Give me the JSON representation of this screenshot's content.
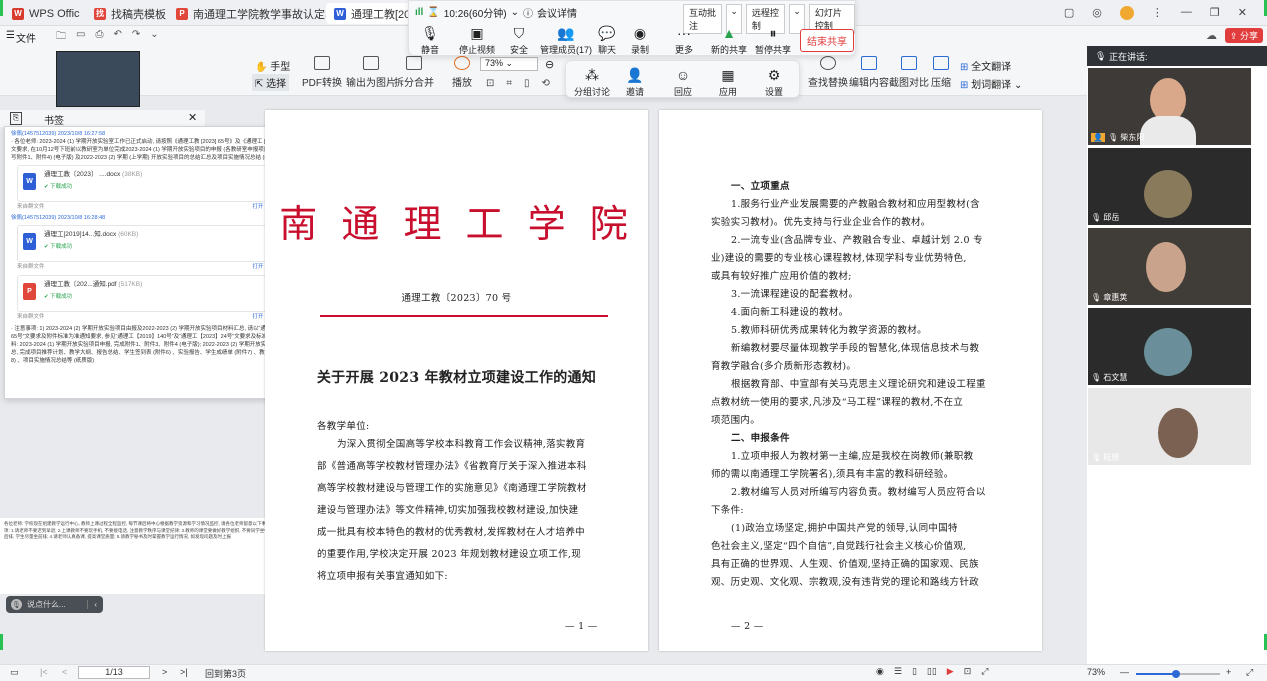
{
  "tabs": [
    {
      "label": "WPS Office",
      "icon": "W",
      "color": "#d83a2e"
    },
    {
      "label": "找稿壳模板",
      "icon": "找",
      "color": "#e0463a"
    },
    {
      "label": "南通理工学院教学事故认定与处理办",
      "icon": "P",
      "color": "#e0463a"
    },
    {
      "label": "通理工教[2023] 7",
      "icon": "W",
      "color": "#2f5fd6"
    }
  ],
  "meeting": {
    "duration": "10:26(60分钟)",
    "details": "会议详情",
    "buttons": {
      "interactive": "互动批注",
      "remote": "远程控制",
      "slides": "幻灯片控制"
    },
    "controls": [
      "静音",
      "停止视频",
      "安全",
      "管理成员(17)",
      "聊天",
      "录制",
      "更多"
    ],
    "share": [
      "新的共享",
      "暂停共享"
    ],
    "end": "结束共享",
    "sub": [
      "分组讨论",
      "邀请",
      "回应",
      "应用",
      "设置"
    ]
  },
  "menu": {
    "file": "文件"
  },
  "ribbon": {
    "hand": "手型",
    "select": "选择",
    "pdf": "PDF转换",
    "export": "输出为图片",
    "split": "拆分合并",
    "play": "播放",
    "zoom": "73%",
    "right": [
      "查找替换",
      "编辑内容",
      "截图对比",
      "压缩"
    ],
    "translate": "全文翻译",
    "word_translate": "划词翻译"
  },
  "bookmark": {
    "label": "书签"
  },
  "chat": {
    "msg1_sender": "徐佩(1457512039) 2023/10/8 16:27:58",
    "msg1_text": "· 各位老师: 2023-2024 (1) 学期开放实验室工作已正式启动, 请按照《通理工教 [2023] 65号》及《通理工 [2019] 140号》文要求, 在10月12号下班前以教研室为单位完成2023-2024 (1) 学期开放实验项目的申报 (各教研室申报项目不少于2项) (填写附件1、附件4) (电子版) 及2022-2023 (2) 学期 (上学期) 开放实验项目的总结汇总及项目实施情况总结 (纸质版) , 谢谢!",
    "file1": {
      "name": "通理工教〔2023〕 ....docx",
      "size": "(38KB)",
      "status": "下载成功",
      "src": "来自群文件",
      "actions": "打开 打开文件夹 转发"
    },
    "msg2_sender": "徐佩(1457512039) 2023/10/8 16:28:48",
    "file2": {
      "name": "通理工[2019]14...知.docx",
      "size": "(60KB)",
      "status": "下载成功",
      "src": "来自群文件",
      "actions": "打开 打开文件夹 转发"
    },
    "file3": {
      "name": "通理工教〔202...通知.pdf",
      "size": "(517KB)",
      "status": "下载成功",
      "src": "来自群文件",
      "actions": "打开 打开文件夹 转发"
    },
    "msg3_text": "· 注意事项: 1) 2023-2024 (2) 学期开放实验项目由报及2022-2023 (2) 学期开放实验项目材料汇总, 请以“通理工教【2023】65号”文要求及附件标准为准通知要求, 参见“通理工【2019】140号”及“通理工【2023】24号”文要求及标准数据; 2) 完成材料: 2023-2024 (1) 学期开放实验项目申报, 完成附件1、附件3、附件4 (电子版); 2022-2023 (2) 学期开放实验项目材料汇总, 完成项目推荐计划、教学大纲、报告总结、学生签到表 (附件6) 、实验报告、学生成绩单 (附件7) 、教师工作量 (附件8) 、项目实施情况总结等 (纸质版)"
  },
  "note": {
    "text": "各位老师: 学校现在组建教学运行中心, 教师上课过程全程监控, 每节课后将中心根据教学资源和学习情况监控, 请各位老师留意以下事项: 1.请老师不要迟到早退; 2.上课教师不要玩手机, 不要接电话, 注意教学秩序与课堂纪律; 3.教师的课堂要做好教学组织, 不要同学坐中后排, 学生尽量坐前排; 4.请老师认真备课, 提高课堂质量; 5.请教学秘书及时掌握教学运行情况, 如发现问题及时上报"
  },
  "say": {
    "placeholder": "说点什么..."
  },
  "doc": {
    "p1": {
      "school": "南 通 理 工 学 院",
      "docno": "通理工教〔2023〕70 号",
      "title": "关于开展 2023 年教材立项建设工作的通知",
      "greet": "各教学单位:",
      "lines": [
        "为深入贯彻全国高等学校本科教育工作会议精神,落实教育",
        "部《普通高等学校教材管理办法》《省教育厅关于深入推进本科",
        "高等学校教材建设与管理工作的实施意见》《南通理工学院教材",
        "建设与管理办法》等文件精神,切实加强我校教材建设,加快建",
        "成一批具有校本特色的教材的优秀教材,发挥教材在人才培养中",
        "的重要作用,学校决定开展 2023 年规划教材建设立项工作,现",
        "将立项申报有关事宜通知如下:"
      ],
      "pagenum": "— 1 —"
    },
    "p2": {
      "lines": [
        "一、立项重点",
        "1.服务行业产业发展需要的产教融合教材和应用型教材(含",
        "实验实习教材)。优先支持与行业企业合作的教材。",
        "2.一流专业(含品牌专业、产教融合专业、卓越计划 2.0 专",
        "业)建设的需要的专业核心课程教材,体现学科专业优势特色,",
        "或具有较好推广应用价值的教材;",
        "3.一流课程建设的配套教材。",
        "4.面向新工科建设的教材。",
        "5.教师科研优秀成果转化为教学资源的教材。",
        "新编教材要尽量体现教学手段的智慧化,体现信息技术与教",
        "育教学融合(多介质新形态教材)。",
        "根据教育部、中宣部有关马克思主义理论研究和建设工程重",
        "点教材统一使用的要求,凡涉及“马工程”课程的教材,不在立",
        "项范围内。",
        "二、申报条件",
        "1.立项申报人为教材第一主编,应是我校在岗教师(兼职教",
        "师的需以南通理工学院署名),须具有丰富的教科研经验。",
        "2.教材编写人员对所编写内容负责。教材编写人员应符合以",
        "下条件:",
        "(1)政治立场坚定,拥护中国共产党的领导,认同中国特",
        "色社会主义,坚定“四个自信”,自觉践行社会主义核心价值观,",
        "具有正确的世界观、人生观、价值观,坚持正确的国家观、民族",
        "观、历史观、文化观、宗教观,没有违背党的理论和路线方针政"
      ],
      "pagenum": "— 2 —"
    }
  },
  "participants": {
    "speaking_label": "正在讲话:",
    "names": [
      "柴东阳",
      "邱岳",
      "章惠荚",
      "石文慧",
      "陆原"
    ]
  },
  "status": {
    "page_input": "1/13",
    "back": "回到第3页",
    "zoom": "73%"
  },
  "top_right": {
    "share": "分享"
  },
  "colors": {
    "accent": "#2d6ad6",
    "red": "#c8102e",
    "end": "#e23d3d"
  }
}
